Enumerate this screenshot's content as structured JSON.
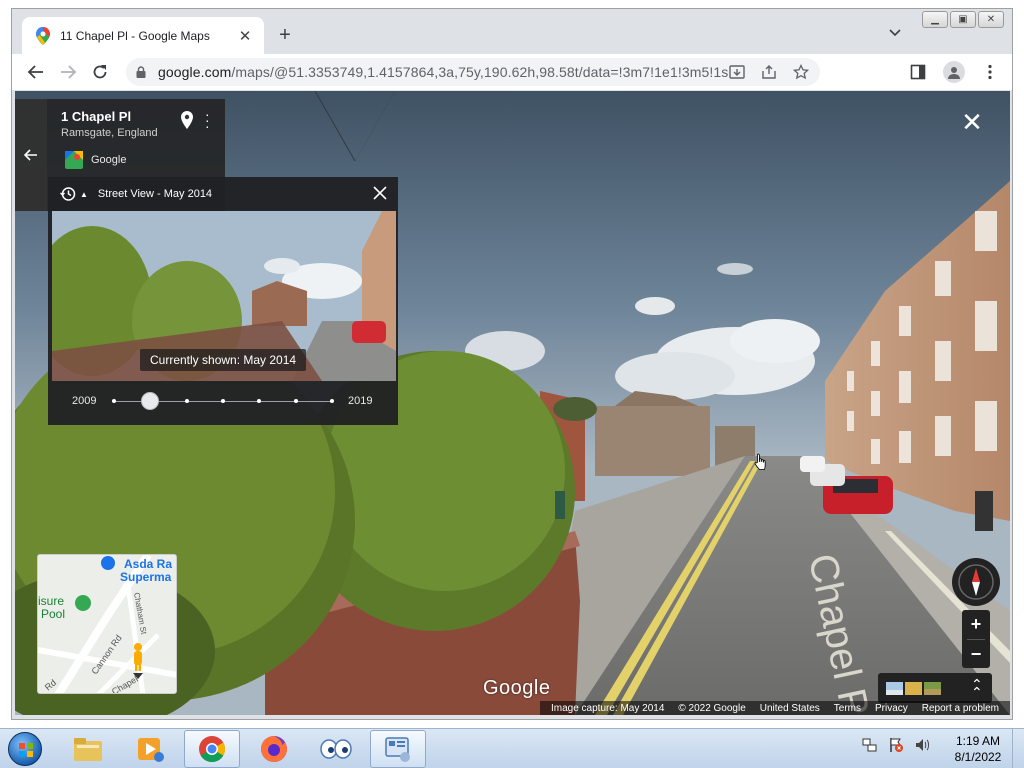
{
  "browser": {
    "tab_title": "11 Chapel Pl - Google Maps",
    "url_host": "google.com",
    "url_path": "/maps/@51.3353749,1.4157864,3a,75y,190.62h,98.58t/data=!3m7!1e1!3m5!1sU-7HaBIRHs..."
  },
  "address_card": {
    "title": "1 Chapel Pl",
    "subtitle": "Ramsgate, England",
    "source": "Google"
  },
  "time_travel": {
    "title": "Street View - May 2014",
    "tooltip": "Currently shown: May 2014",
    "year_start": "2009",
    "year_end": "2019",
    "selected_index": 1,
    "tick_count": 7
  },
  "minimap": {
    "labels": [
      "Asda Ra",
      "Superma",
      "isure",
      "Pool",
      "Chatham St",
      "Cannon Rd",
      "Chapel",
      "Rd"
    ]
  },
  "street_label": "Chapel Pl",
  "google_logo": "Google",
  "footer": {
    "capture": "Image capture: May 2014",
    "copyright": "© 2022 Google",
    "region": "United States",
    "terms": "Terms",
    "privacy": "Privacy",
    "report": "Report a problem"
  },
  "taskbar": {
    "time": "1:19 AM",
    "date": "8/1/2022"
  },
  "colors": {
    "chrome_tabstrip": "#dee1e6",
    "panel_dark": "#202124",
    "taskbar": "#bfd3ea"
  }
}
